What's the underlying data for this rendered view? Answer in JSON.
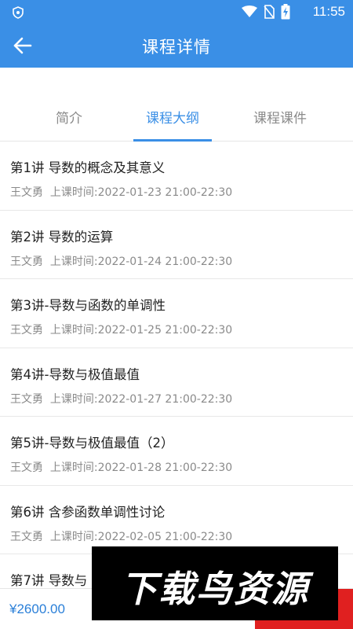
{
  "status_bar": {
    "time": "11:55"
  },
  "app_bar": {
    "title": "课程详情"
  },
  "tabs": [
    {
      "label": "简介",
      "active": false
    },
    {
      "label": "课程大纲",
      "active": true
    },
    {
      "label": "课程课件",
      "active": false
    }
  ],
  "lessons": [
    {
      "title": "第1讲 导数的概念及其意义",
      "teacher": "王文勇",
      "time_label": "上课时间:",
      "time": "2022-01-23 21:00-22:30"
    },
    {
      "title": "第2讲 导数的运算",
      "teacher": "王文勇",
      "time_label": "上课时间:",
      "time": "2022-01-24 21:00-22:30"
    },
    {
      "title": "第3讲-导数与函数的单调性",
      "teacher": "王文勇",
      "time_label": "上课时间:",
      "time": "2022-01-25 21:00-22:30"
    },
    {
      "title": "第4讲-导数与极值最值",
      "teacher": "王文勇",
      "time_label": "上课时间:",
      "time": "2022-01-27 21:00-22:30"
    },
    {
      "title": "第5讲-导数与极值最值（2）",
      "teacher": "王文勇",
      "time_label": "上课时间:",
      "time": "2022-01-28 21:00-22:30"
    },
    {
      "title": "第6讲 含参函数单调性讨论",
      "teacher": "王文勇",
      "time_label": "上课时间:",
      "time": "2022-02-05 21:00-22:30"
    },
    {
      "title": "第7讲 导数与",
      "teacher": "",
      "time_label": "",
      "time": ""
    }
  ],
  "bottom_bar": {
    "price": "¥2600.00"
  },
  "watermark": {
    "text": "下载鸟资源"
  },
  "colors": {
    "primary": "#3a8fe6",
    "buy_button": "#e02020"
  }
}
